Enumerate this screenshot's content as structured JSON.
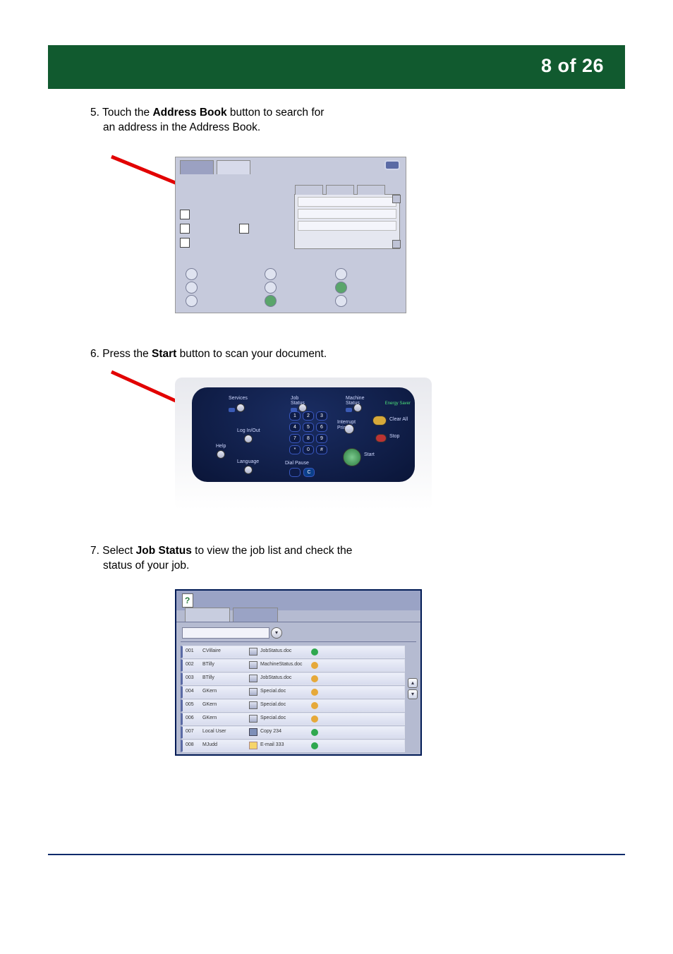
{
  "header": {
    "page_counter": "8 of 26"
  },
  "steps": {
    "s5_line1": "5. Touch the ",
    "s5_bold": "Address Book",
    "s5_line2": " button to search for",
    "s5_indent": "an address in the Address Book.",
    "s6_line1": "6. Press the ",
    "s6_bold": "Start",
    "s6_line2": " button to scan your document.",
    "s7_line1": "7. Select ",
    "s7_bold": "Job Status",
    "s7_line2": " to view the job list and check the",
    "s7_indent": "status of your job."
  },
  "shot2_labels": {
    "services": "Services",
    "jobstatus": "Job Status",
    "machinestatus": "Machine Status",
    "energy": "Energy Saver",
    "clearall": "Clear All",
    "stop": "Stop",
    "start": "Start",
    "interrupt1": "Interrupt",
    "interrupt2": "Printer",
    "loginout": "Log In/Out",
    "help": "Help",
    "language": "Language",
    "keys": [
      "1",
      "2",
      "3",
      "4",
      "5",
      "6",
      "7",
      "8",
      "9",
      "*",
      "0",
      "#"
    ],
    "dialpause": "Dial Pause",
    "ckey": "C"
  },
  "shot3": {
    "rows": [
      {
        "num": "001",
        "owner": "CVillaire",
        "name": "JobStatus.doc",
        "icon": "printer",
        "status": "arrow"
      },
      {
        "num": "002",
        "owner": "BTilly",
        "name": "MachineStatus.doc",
        "icon": "printer",
        "status": "warn"
      },
      {
        "num": "003",
        "owner": "BTilly",
        "name": "JobStatus.doc",
        "icon": "printer",
        "status": "warn"
      },
      {
        "num": "004",
        "owner": "GKern",
        "name": "Special.doc",
        "icon": "printer",
        "status": "warn"
      },
      {
        "num": "005",
        "owner": "GKern",
        "name": "Special.doc",
        "icon": "printer",
        "status": "warn"
      },
      {
        "num": "006",
        "owner": "GKern",
        "name": "Special.doc",
        "icon": "printer",
        "status": "warn"
      },
      {
        "num": "007",
        "owner": "Local User",
        "name": "Copy 234",
        "icon": "copy",
        "status": "green"
      },
      {
        "num": "008",
        "owner": "MJudd",
        "name": "E-mail 333",
        "icon": "mail",
        "status": "green"
      }
    ]
  }
}
